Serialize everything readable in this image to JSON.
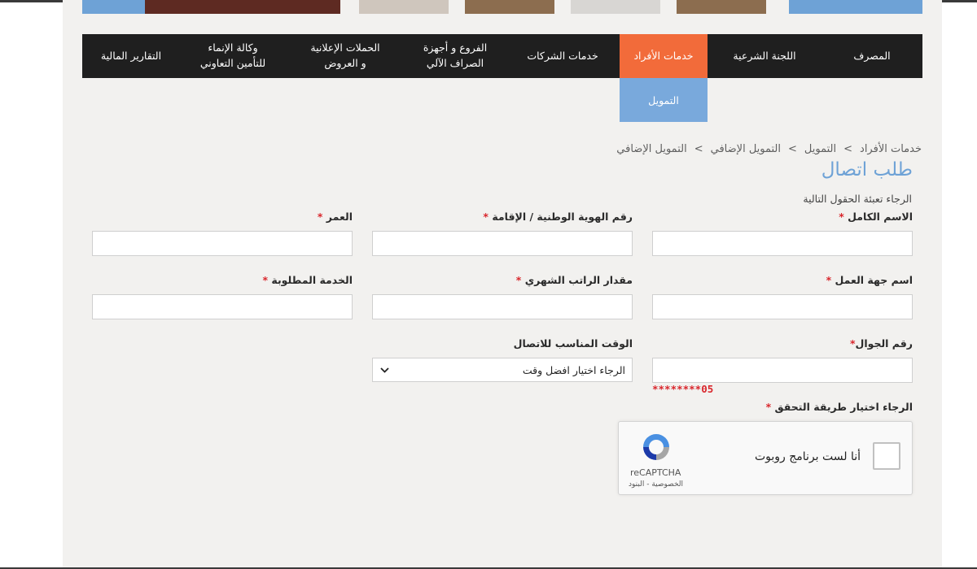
{
  "colors": {
    "nav_bg": "#1f1f1f",
    "nav_active": "#f26b3a",
    "submenu_bg": "#79a9dc",
    "title": "#6ea2d6",
    "required": "#d9262c",
    "page_bg": "#f2f1ef"
  },
  "nav": {
    "items": [
      {
        "label": "المصرف"
      },
      {
        "label": "اللجنة الشرعية"
      },
      {
        "label": "خدمات الأفراد"
      },
      {
        "label": "خدمات الشركات"
      },
      {
        "label": "الفروع و أجهزة\nالصراف الآلي"
      },
      {
        "label": "الحملات الإعلانية\nو العروض"
      },
      {
        "label": "وكالة الإنماء\nللتأمين التعاوني"
      },
      {
        "label": "التقارير المالية"
      }
    ],
    "active_index": 2,
    "submenu": {
      "label": "التمويل"
    }
  },
  "breadcrumb": {
    "items": [
      "خدمات الأفراد",
      "التمويل",
      "التمويل الإضافي",
      "التمويل الإضافي"
    ],
    "separator": ">"
  },
  "page": {
    "title": "طلب اتصال",
    "instructions": "الرجاء تعبئة الحقول التالية"
  },
  "form": {
    "required_mark": "*",
    "full_name": {
      "label": "الاسم الكامل",
      "value": ""
    },
    "national_id": {
      "label": "رقم الهوية الوطنية / الإقامة",
      "value": ""
    },
    "age": {
      "label": "العمر",
      "value": ""
    },
    "employer": {
      "label": "اسم جهة العمل",
      "value": ""
    },
    "salary": {
      "label": "مقدار الراتب الشهري",
      "value": ""
    },
    "service": {
      "label": "الخدمة المطلوبة",
      "value": ""
    },
    "mobile": {
      "label": "رقم الجوال",
      "value": "",
      "hint": "05********"
    },
    "contact_time": {
      "label": "الوقت المناسب للاتصال",
      "selected": "الرجاء اختيار افضل وقت"
    },
    "verification": {
      "label": "الرجاء اختيار طريقة التحقق"
    }
  },
  "recaptcha": {
    "label": "أنا لست برنامج روبوت",
    "brand": "reCAPTCHA",
    "privacy": "الخصوصية",
    "terms": "البنود",
    "links_sep": " - "
  }
}
